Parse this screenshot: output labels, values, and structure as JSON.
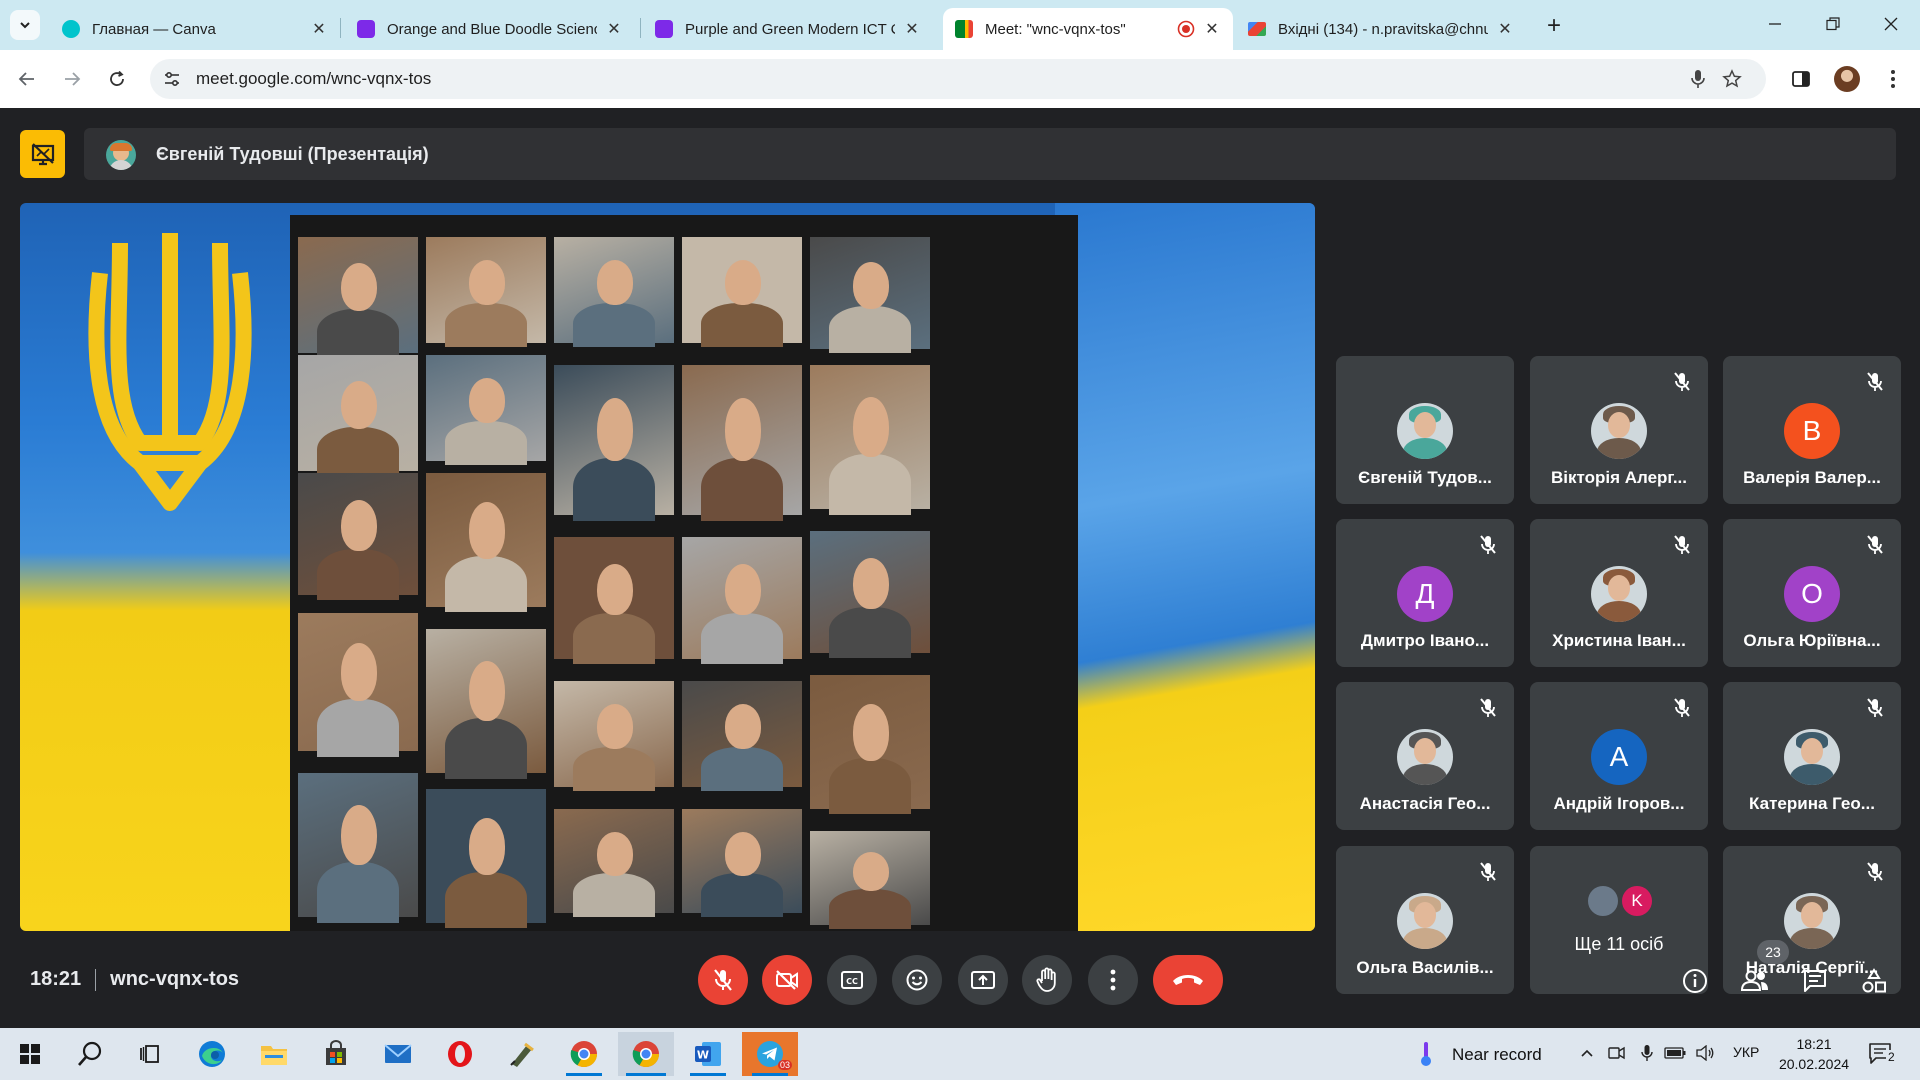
{
  "browser": {
    "tabs": [
      {
        "title": "Главная — Canva",
        "favicon_color": "#00c4cc",
        "active": false
      },
      {
        "title": "Orange and Blue Doodle Scienc",
        "favicon_color": "#7d2ae8",
        "active": false
      },
      {
        "title": "Purple and Green Modern ICT C",
        "favicon_color": "#7d2ae8",
        "active": false
      },
      {
        "title": "Meet: \"wnc-vqnx-tos\"",
        "favicon_color": "#00832d",
        "active": true
      },
      {
        "title": "Вхідні (134) - n.pravitska@chnu",
        "favicon_color": "#ea4335",
        "active": false
      }
    ],
    "url": "meet.google.com/wnc-vqnx-tos"
  },
  "meet": {
    "presenter_label": "Євгеній Тудовші (Презентація)",
    "participants": [
      {
        "name": "Євгеній Тудов...",
        "avatar_type": "photo",
        "avatar_color": "#4aa79b",
        "muted": false
      },
      {
        "name": "Вікторія Алерг...",
        "avatar_type": "photo",
        "avatar_color": "#6d5a4b",
        "muted": true
      },
      {
        "name": "Валерія Валер...",
        "avatar_type": "letter",
        "letter": "В",
        "avatar_color": "#f4511e",
        "muted": true
      },
      {
        "name": "Дмитро Івано...",
        "avatar_type": "letter",
        "letter": "Д",
        "avatar_color": "#a142c8",
        "muted": true
      },
      {
        "name": "Христина Іван...",
        "avatar_type": "photo",
        "avatar_color": "#8a5a3c",
        "muted": true
      },
      {
        "name": "Ольга Юріївна...",
        "avatar_type": "letter",
        "letter": "О",
        "avatar_color": "#a142c8",
        "muted": true
      },
      {
        "name": "Анастасія Гео...",
        "avatar_type": "photo",
        "avatar_color": "#555555",
        "muted": true
      },
      {
        "name": "Андрій Ігоров...",
        "avatar_type": "letter",
        "letter": "А",
        "avatar_color": "#1565c0",
        "muted": true
      },
      {
        "name": "Катерина Гео...",
        "avatar_type": "photo",
        "avatar_color": "#3d5b6b",
        "muted": true
      },
      {
        "name": "Ольга Василів...",
        "avatar_type": "photo",
        "avatar_color": "#c9a98a",
        "muted": true
      },
      {
        "name": "Ще 11 осіб",
        "avatar_type": "group",
        "letter": "K",
        "avatar_color": "#d81b60",
        "muted": false
      },
      {
        "name": "Наталія Сергії...",
        "avatar_type": "photo",
        "avatar_color": "#7a6655",
        "muted": true
      }
    ],
    "time": "18:21",
    "meeting_code": "wnc-vqnx-tos",
    "people_count": "23"
  },
  "taskbar": {
    "weather": "Near record",
    "language": "УКР",
    "time": "18:21",
    "date": "20.02.2024",
    "notification_count": "2",
    "telegram_badge": "03"
  },
  "colors": {
    "meet_bg": "#202124",
    "tile_bg": "#3c4043",
    "danger": "#ea4335",
    "presenting_accent": "#fbbc04",
    "tabstrip": "#cde9f2"
  }
}
